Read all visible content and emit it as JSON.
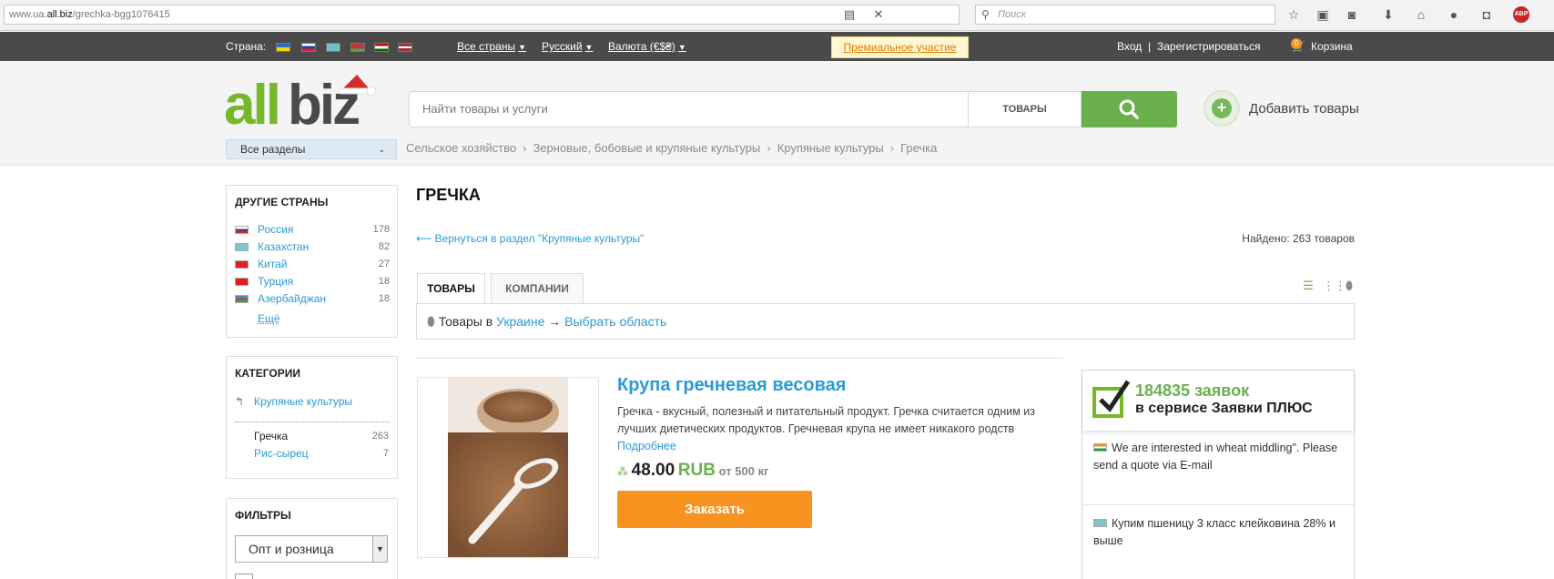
{
  "browser": {
    "url_prefix": "www.ua.",
    "url_domain": "all.biz",
    "url_path": "/grechka-bgg1076415",
    "search_placeholder": "Поиск"
  },
  "topbar": {
    "country_label": "Страна:",
    "all_countries": "Все страны",
    "language": "Русский",
    "currency": "Валюта (€$₴)",
    "premium": "Премиальное участие",
    "login": "Вход",
    "divider": "|",
    "register": "Зарегистрироваться",
    "cart_count": "0",
    "cart": "Корзина"
  },
  "header": {
    "search_placeholder": "Найти товары и услуги",
    "search_category": "ТОВАРЫ",
    "add_products": "Добавить товары",
    "all_sections": "Все разделы"
  },
  "breadcrumb": [
    "Сельское хозяйство",
    "Зерновые, бобовые и крупяные культуры",
    "Крупяные культуры",
    "Гречка"
  ],
  "sidebar": {
    "countries_title": "ДРУГИЕ СТРАНЫ",
    "countries": [
      {
        "name": "Россия",
        "count": "178"
      },
      {
        "name": "Казахстан",
        "count": "82"
      },
      {
        "name": "Китай",
        "count": "27"
      },
      {
        "name": "Турция",
        "count": "18"
      },
      {
        "name": "Азербайджан",
        "count": "18"
      }
    ],
    "more": "Ещё",
    "categories_title": "КАТЕГОРИИ",
    "parent_category": "Крупяные культуры",
    "subcategories": [
      {
        "name": "Гречка",
        "count": "263"
      },
      {
        "name": "Рис-сырец",
        "count": "7"
      }
    ],
    "filters_title": "ФИЛЬТРЫ",
    "filter_select": "Опт и розница"
  },
  "main": {
    "title": "ГРЕЧКА",
    "back_link": "⟵ Вернуться в раздел \"Крупяные культуры\"",
    "found": "Найдено: 263 товаров",
    "tabs": [
      "ТОВАРЫ",
      "КОМПАНИИ"
    ],
    "region_prefix": "Товары в",
    "region_country": "Украине",
    "region_arrow": "→",
    "region_choose": "Выбрать область"
  },
  "product": {
    "title": "Крупа гречневая весовая",
    "description": "Гречка - вкусный, полезный и питательный продукт. Гречка считается одним из лучших диетических продуктов. Гречневая крупа не имеет никакого родств",
    "more": "Подробнее",
    "price": "48.00",
    "currency": "RUB",
    "min_order": "от 500 кг",
    "order_button": "Заказать"
  },
  "requests": {
    "count": "184835 заявок",
    "service": "в сервисе Заявки ПЛЮС",
    "items": [
      "We are interested in wheat middling\". Please send a quote via E-mail",
      "Купим пшеницу 3 класс клейковина 28% и выше"
    ]
  },
  "colors": {
    "accent_blue": "#2a9bd6",
    "accent_green": "#6ab04c",
    "order_orange": "#f7931e",
    "topbar_bg": "#4a4a4a"
  }
}
